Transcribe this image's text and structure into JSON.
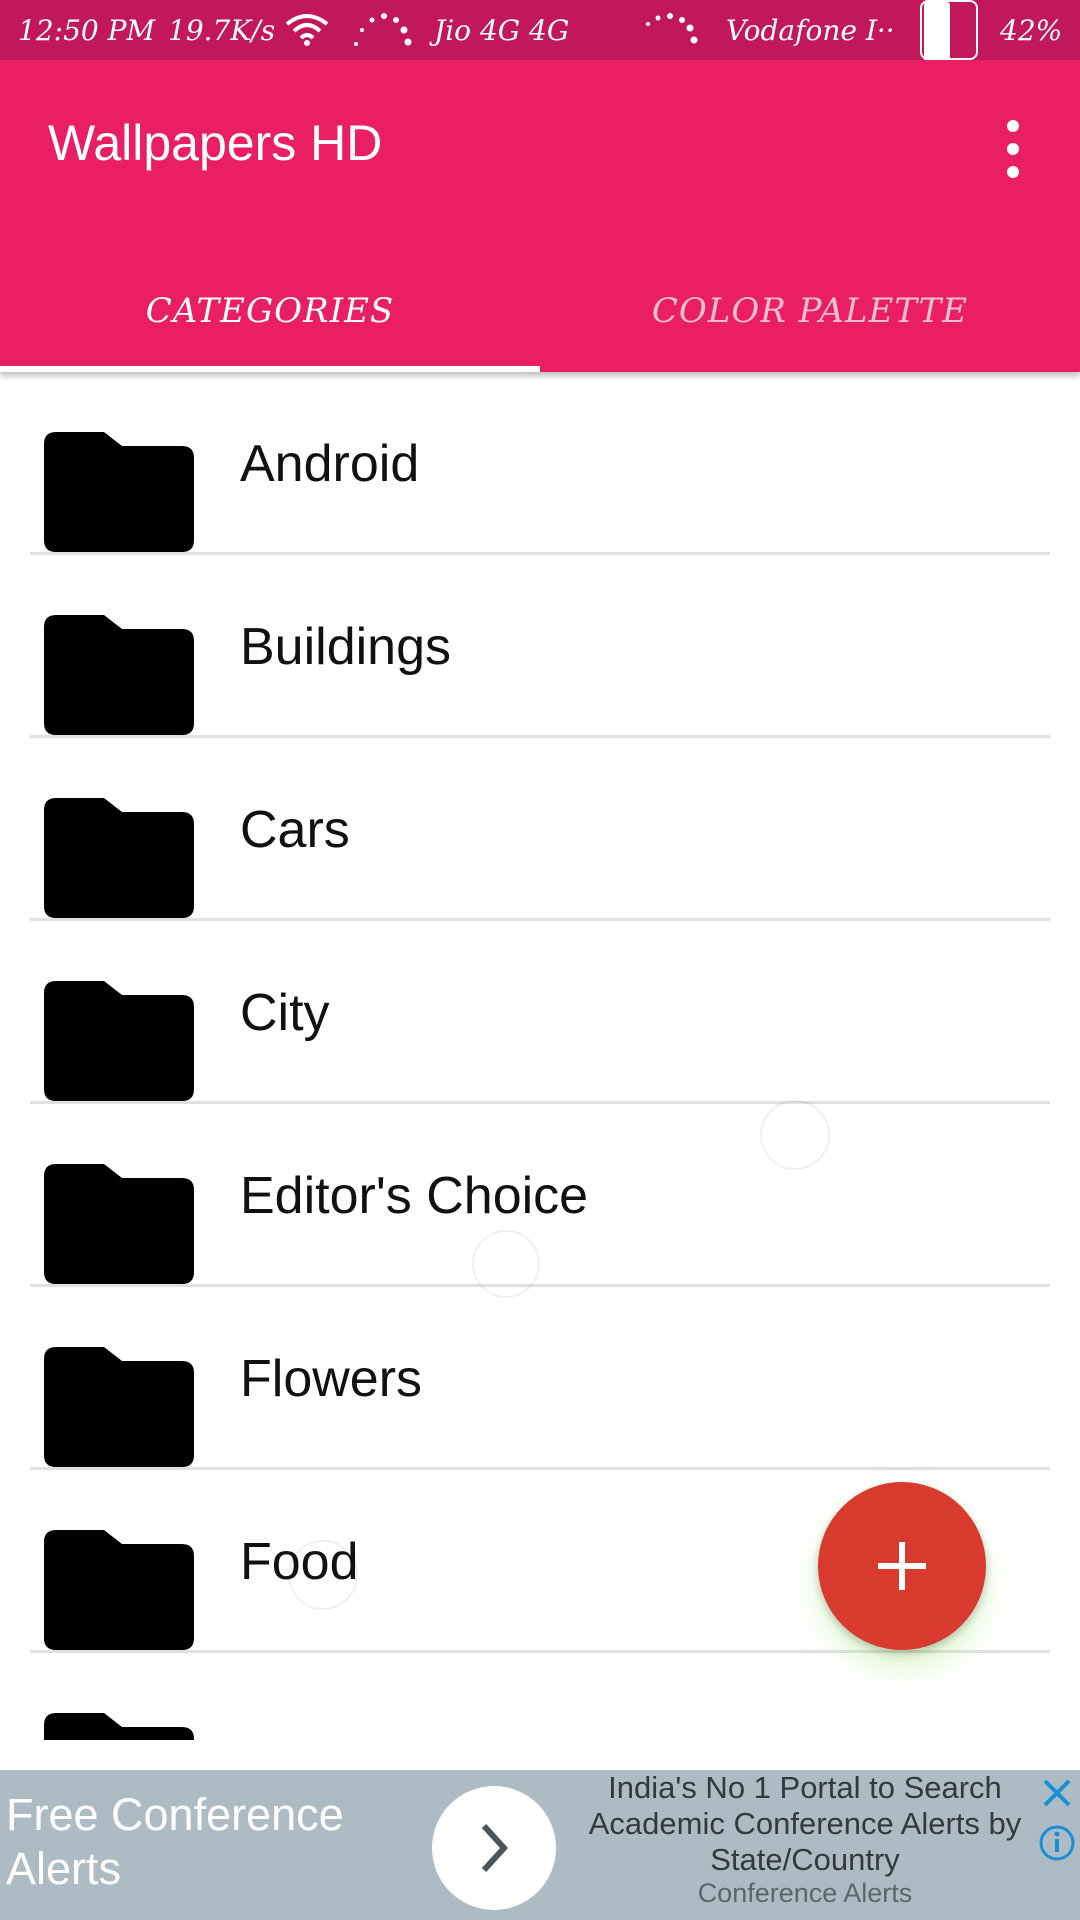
{
  "status_bar": {
    "time": "12:50 PM",
    "speed": "19.7K/s",
    "carrier1": "Jio 4G 4G",
    "carrier2": "Vodafone I··",
    "battery": "42%"
  },
  "app_bar": {
    "title": "Wallpapers HD",
    "tabs": [
      {
        "label": "CATEGORIES",
        "selected": true
      },
      {
        "label": "COLOR PALETTE",
        "selected": false
      }
    ]
  },
  "categories": [
    {
      "label": "Android"
    },
    {
      "label": "Buildings"
    },
    {
      "label": "Cars"
    },
    {
      "label": "City"
    },
    {
      "label": "Editor's Choice"
    },
    {
      "label": "Flowers"
    },
    {
      "label": "Food"
    },
    {
      "label": ""
    }
  ],
  "fab": {
    "icon": "plus-icon",
    "color": "#d83a2e"
  },
  "ad": {
    "headline": "Free Conference Alerts",
    "description": "India's No 1 Portal to Search Academic Conference Alerts by State/Country",
    "source": "Conference Alerts"
  },
  "colors": {
    "status_bar": "#c2185b",
    "primary": "#e91e63",
    "fab": "#d83a2e",
    "ad_background": "#adbcc4"
  }
}
